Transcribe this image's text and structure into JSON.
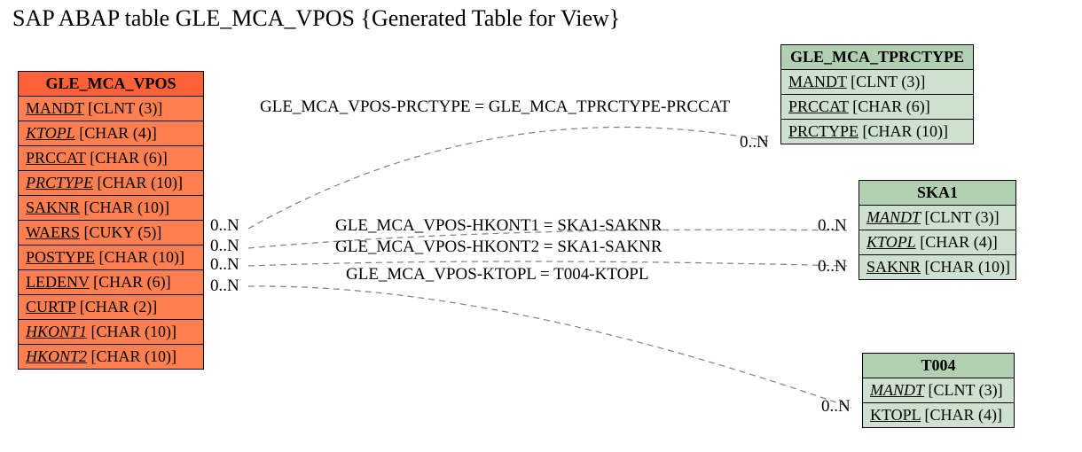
{
  "title": "SAP ABAP table GLE_MCA_VPOS {Generated Table for View}",
  "colors": {
    "main_header": "#fc6138",
    "main_row": "#ff7f50",
    "ref_header": "#b1d0b1",
    "ref_row": "#cee0ce"
  },
  "entities": {
    "main": {
      "name": "GLE_MCA_VPOS",
      "fields": [
        {
          "name": "MANDT",
          "type": "[CLNT (3)]",
          "italic": false
        },
        {
          "name": "KTOPL",
          "type": "[CHAR (4)]",
          "italic": true
        },
        {
          "name": "PRCCAT",
          "type": "[CHAR (6)]",
          "italic": false
        },
        {
          "name": "PRCTYPE",
          "type": "[CHAR (10)]",
          "italic": true
        },
        {
          "name": "SAKNR",
          "type": "[CHAR (10)]",
          "italic": false
        },
        {
          "name": "WAERS",
          "type": "[CUKY (5)]",
          "italic": false
        },
        {
          "name": "POSTYPE",
          "type": "[CHAR (10)]",
          "italic": false
        },
        {
          "name": "LEDENV",
          "type": "[CHAR (6)]",
          "italic": false
        },
        {
          "name": "CURTP",
          "type": "[CHAR (2)]",
          "italic": false
        },
        {
          "name": "HKONT1",
          "type": "[CHAR (10)]",
          "italic": true
        },
        {
          "name": "HKONT2",
          "type": "[CHAR (10)]",
          "italic": true
        }
      ]
    },
    "tprctype": {
      "name": "GLE_MCA_TPRCTYPE",
      "fields": [
        {
          "name": "MANDT",
          "type": "[CLNT (3)]",
          "italic": false
        },
        {
          "name": "PRCCAT",
          "type": "[CHAR (6)]",
          "italic": false
        },
        {
          "name": "PRCTYPE",
          "type": "[CHAR (10)]",
          "italic": false
        }
      ]
    },
    "ska1": {
      "name": "SKA1",
      "fields": [
        {
          "name": "MANDT",
          "type": "[CLNT (3)]",
          "italic": true
        },
        {
          "name": "KTOPL",
          "type": "[CHAR (4)]",
          "italic": true
        },
        {
          "name": "SAKNR",
          "type": "[CHAR (10)]",
          "italic": false
        }
      ]
    },
    "t004": {
      "name": "T004",
      "fields": [
        {
          "name": "MANDT",
          "type": "[CLNT (3)]",
          "italic": true
        },
        {
          "name": "KTOPL",
          "type": "[CHAR (4)]",
          "italic": false
        }
      ]
    }
  },
  "relations": {
    "r1": "GLE_MCA_VPOS-PRCTYPE = GLE_MCA_TPRCTYPE-PRCCAT",
    "r2": "GLE_MCA_VPOS-HKONT1 = SKA1-SAKNR",
    "r3": "GLE_MCA_VPOS-HKONT2 = SKA1-SAKNR",
    "r4": "GLE_MCA_VPOS-KTOPL = T004-KTOPL"
  },
  "card": {
    "left_r1": "0..N",
    "right_r1": "0..N",
    "left_r2": "0..N",
    "right_r2": "0..N",
    "left_r3": "0..N",
    "right_r3": "0..N",
    "left_r4": "0..N",
    "right_r4": "0..N"
  }
}
